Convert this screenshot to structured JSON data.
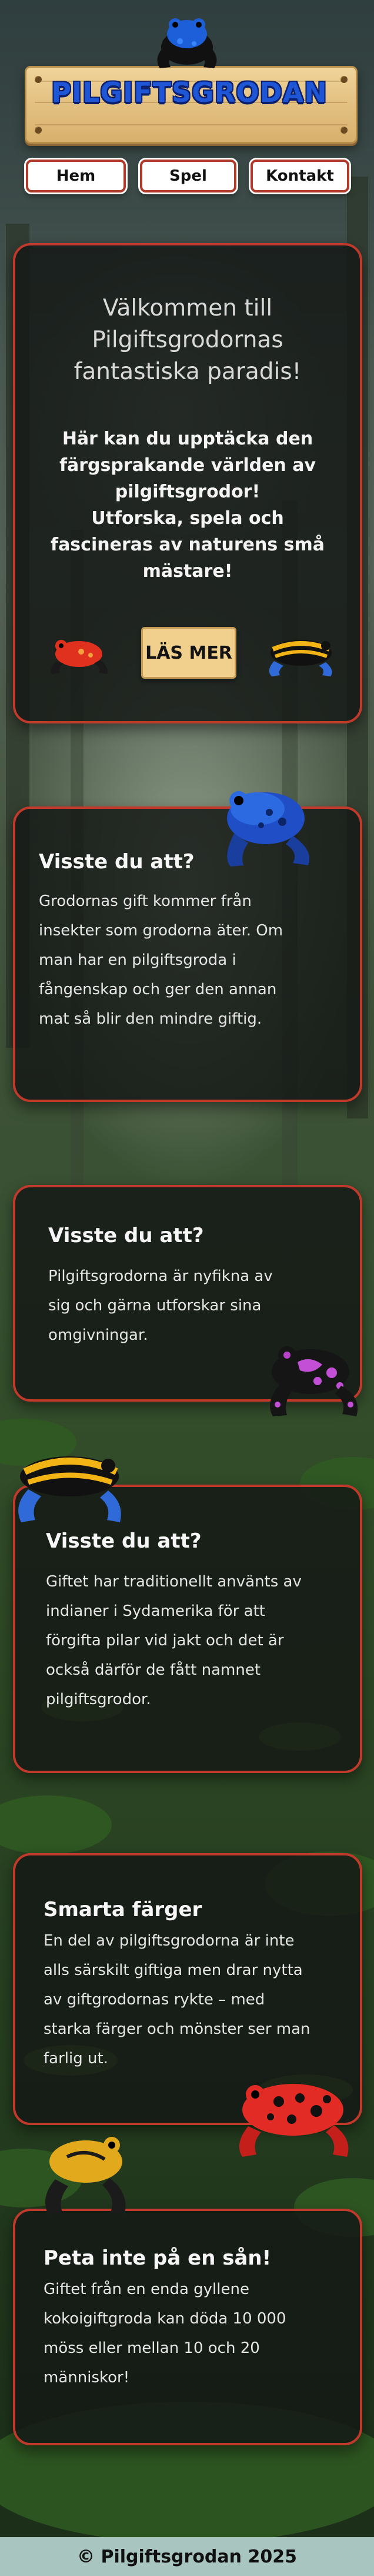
{
  "logo": {
    "text": "PILGIFTSGRODAN"
  },
  "nav": {
    "items": [
      "Hem",
      "Spel",
      "Kontakt"
    ]
  },
  "hero": {
    "title_line1": "Välkommen till",
    "title_line2": "Pilgiftsgrodornas",
    "title_line3": "fantastiska paradis!",
    "intro_lines": [
      "Här kan du upptäcka den",
      "färgsprakande världen av",
      "pilgiftsgrodor!",
      "Utforska, spela och",
      "fascineras av naturens små",
      "mästare!"
    ],
    "button_label": "LÄS MER"
  },
  "cards": [
    {
      "title": "Visste du att?",
      "lines": [
        "Grodornas gift kommer från",
        "insekter som grodorna äter. Om",
        "man har en pilgiftsgroda i",
        "fångenskap och ger den annan",
        "mat så blir den mindre giftig."
      ]
    },
    {
      "title": "Visste du att?",
      "lines": [
        "Pilgiftsgrodorna är nyfikna av",
        "sig och gärna utforskar sina",
        "omgivningar."
      ]
    },
    {
      "title": "Visste du att?",
      "lines": [
        "Giftet har traditionellt använts av",
        "indianer i Sydamerika för att",
        "förgifta pilar vid jakt och det är",
        "också därför de fått namnet",
        "pilgiftsgrodor."
      ]
    },
    {
      "title": "Smarta färger",
      "lines": [
        "En del av pilgiftsgrodorna är inte",
        "alls särskilt giftiga men drar nytta",
        "av giftgrodornas rykte – med",
        "starka färger och mönster ser man",
        "farlig ut."
      ]
    },
    {
      "title": "Peta inte på en sån!",
      "lines": [
        "Giftet från en enda gyllene",
        "kokoigiftgroda kan döda 10 000",
        "möss eller mellan 10 och 20",
        "människor!"
      ]
    }
  ],
  "footer": {
    "text": "© Pilgiftsgrodan 2025"
  },
  "colors": {
    "card_border": "#c0392b",
    "card_bg": "#141816",
    "logo_blue": "#1f56d6",
    "plank": "#e4c283",
    "footer_bg": "#a8c6bf"
  },
  "icons": [
    "blue-frog-icon",
    "red-frog-icon",
    "yellow-black-frog-icon",
    "purple-frog-icon",
    "red-spotted-frog-icon",
    "yellow-frog-icon"
  ]
}
